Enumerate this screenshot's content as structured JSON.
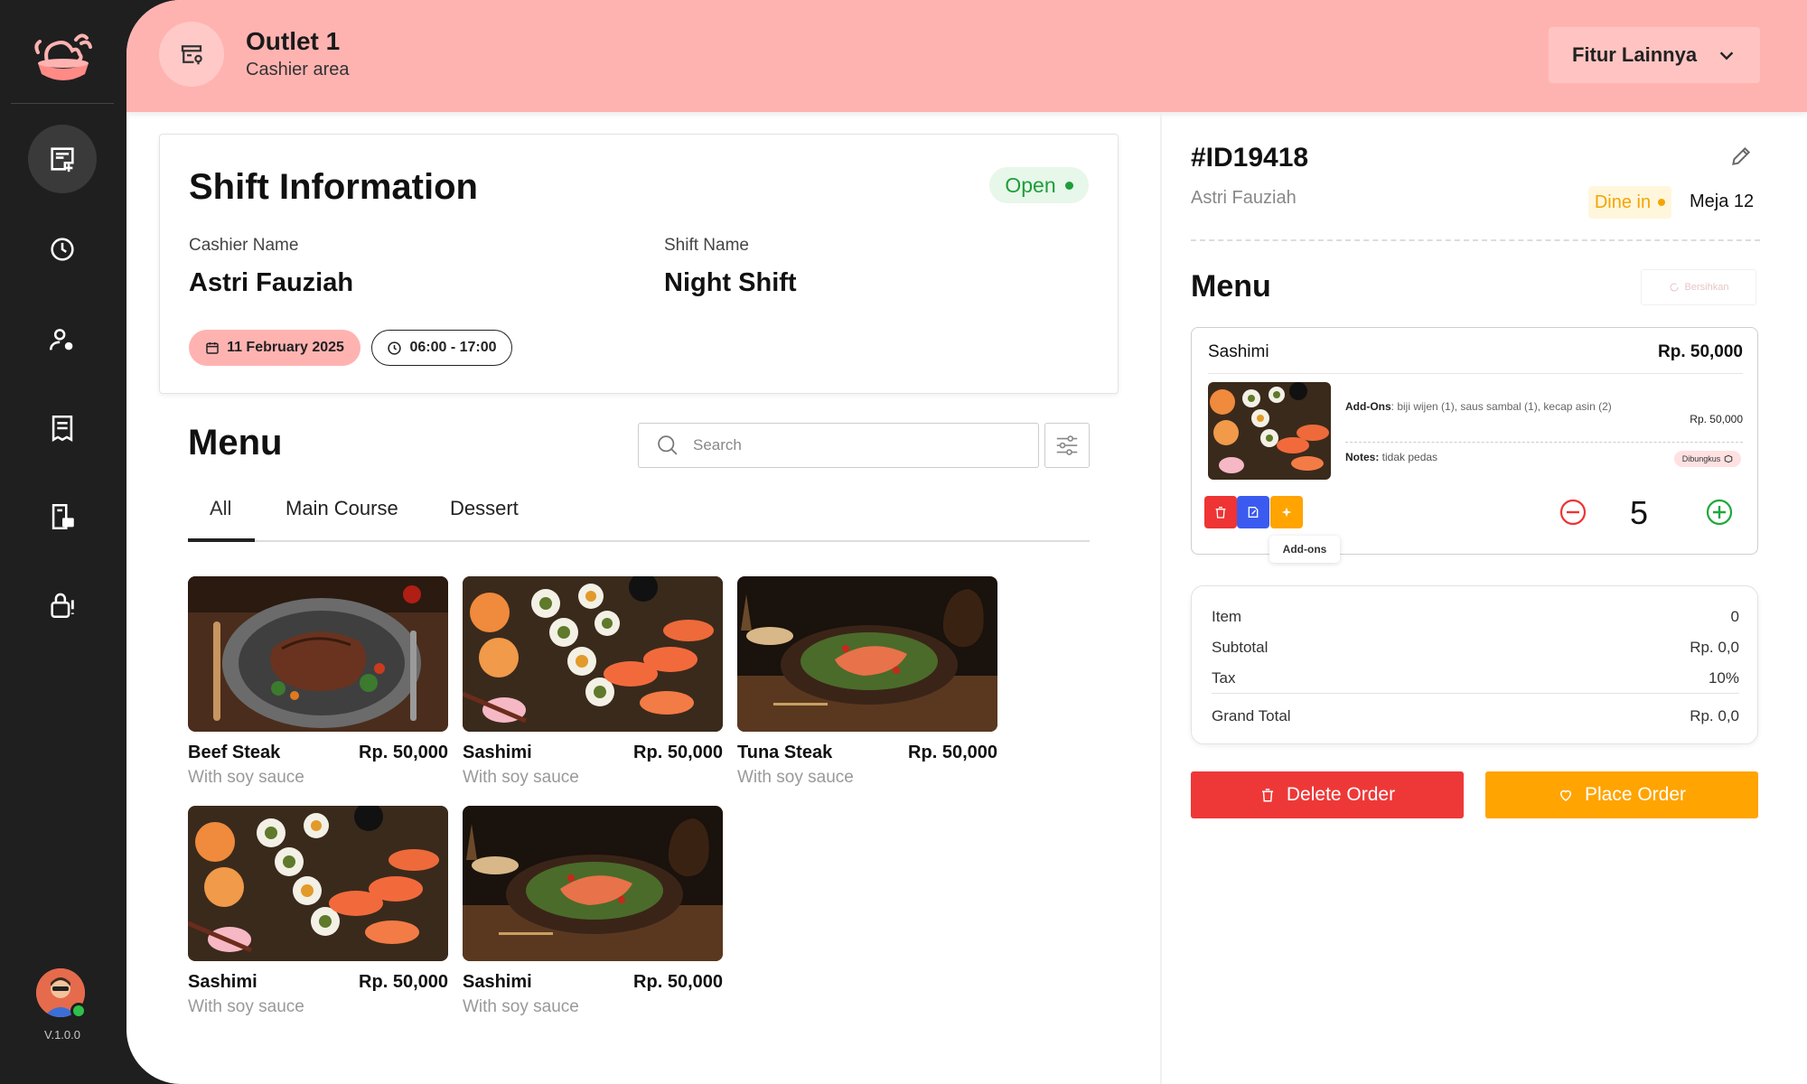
{
  "sidebar": {
    "version": "V.1.0.0",
    "items": [
      {
        "icon": "new-order-icon"
      },
      {
        "icon": "history-icon"
      },
      {
        "icon": "user-settings-icon"
      },
      {
        "icon": "receipt-icon"
      },
      {
        "icon": "print-report-icon"
      },
      {
        "icon": "lock-alert-icon"
      }
    ]
  },
  "header": {
    "outlet_title": "Outlet 1",
    "outlet_subtitle": "Cashier area",
    "more_features": "Fitur Lainnya"
  },
  "shift": {
    "title": "Shift Information",
    "status": "Open",
    "cashier_label": "Cashier Name",
    "cashier_value": "Astri Fauziah",
    "shift_label": "Shift Name",
    "shift_value": "Night Shift",
    "date": "11 February 2025",
    "time": "06:00 - 17:00"
  },
  "menu": {
    "title": "Menu",
    "search_placeholder": "Search",
    "tabs": [
      "All",
      "Main Course",
      "Dessert"
    ],
    "active_tab": "All",
    "items": [
      {
        "name": "Beef Steak",
        "price": "Rp. 50,000",
        "desc": "With soy sauce"
      },
      {
        "name": "Sashimi",
        "price": "Rp. 50,000",
        "desc": "With soy sauce"
      },
      {
        "name": "Tuna Steak",
        "price": "Rp. 50,000",
        "desc": "With soy sauce"
      },
      {
        "name": "Sashimi",
        "price": "Rp. 50,000",
        "desc": "With soy sauce"
      },
      {
        "name": "Sashimi",
        "price": "Rp. 50,000",
        "desc": "With soy sauce"
      }
    ]
  },
  "order": {
    "id": "#ID19418",
    "customer": "Astri Fauziah",
    "type": "Dine in",
    "table": "Meja 12",
    "menu_title": "Menu",
    "clear_label": "Bersihkan",
    "line_item": {
      "name": "Sashimi",
      "price": "Rp. 50,000",
      "addons_label": "Add-Ons",
      "addons_text": ": biji wijen (1), saus sambal (1), kecap asin (2)",
      "addons_price": "Rp. 50,000",
      "notes_label": "Notes:",
      "notes_text": " tidak pedas",
      "packaging": "Dibungkus",
      "quantity": "5",
      "tooltip": "Add-ons"
    },
    "summary": {
      "item_label": "Item",
      "item_value": "0",
      "subtotal_label": "Subtotal",
      "subtotal_value": "Rp. 0,0",
      "tax_label": "Tax",
      "tax_value": "10%",
      "grand_label": "Grand Total",
      "grand_value": "Rp. 0,0"
    },
    "delete_label": "Delete Order",
    "place_label": "Place Order"
  },
  "colors": {
    "header_bg": "#ffb3b1",
    "delete": "#ee3838",
    "place": "#ffa400",
    "open_green": "#1f9d3a",
    "dine_orange": "#f5a400"
  }
}
